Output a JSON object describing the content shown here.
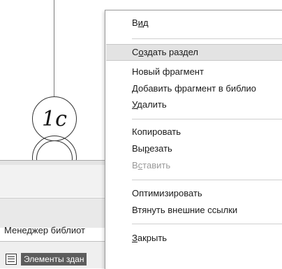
{
  "drawing": {
    "marker_label": "1с"
  },
  "panel": {
    "title": "Менеджер библиот",
    "library_item": "Элементы здан"
  },
  "menu": {
    "items": [
      {
        "pre": "В",
        "u": "и",
        "post": "д",
        "disabled": false
      },
      {
        "pre": "С",
        "u": "о",
        "post": "здать раздел",
        "disabled": false
      },
      {
        "pre": "Новый фрагмент",
        "u": "",
        "post": "",
        "disabled": false
      },
      {
        "pre": "Добавить фрагмент в библио",
        "u": "",
        "post": "",
        "disabled": false
      },
      {
        "pre": "",
        "u": "У",
        "post": "далить",
        "disabled": false
      },
      {
        "pre": "Копировать",
        "u": "",
        "post": "",
        "disabled": false
      },
      {
        "pre": "Вы",
        "u": "р",
        "post": "езать",
        "disabled": false
      },
      {
        "pre": "В",
        "u": "с",
        "post": "тавить",
        "disabled": true
      },
      {
        "pre": "Оптимизировать",
        "u": "",
        "post": "",
        "disabled": false
      },
      {
        "pre": "Втянуть внешние ссылки",
        "u": "",
        "post": "",
        "disabled": false
      },
      {
        "pre": "",
        "u": "З",
        "post": "акрыть",
        "disabled": false
      }
    ]
  }
}
